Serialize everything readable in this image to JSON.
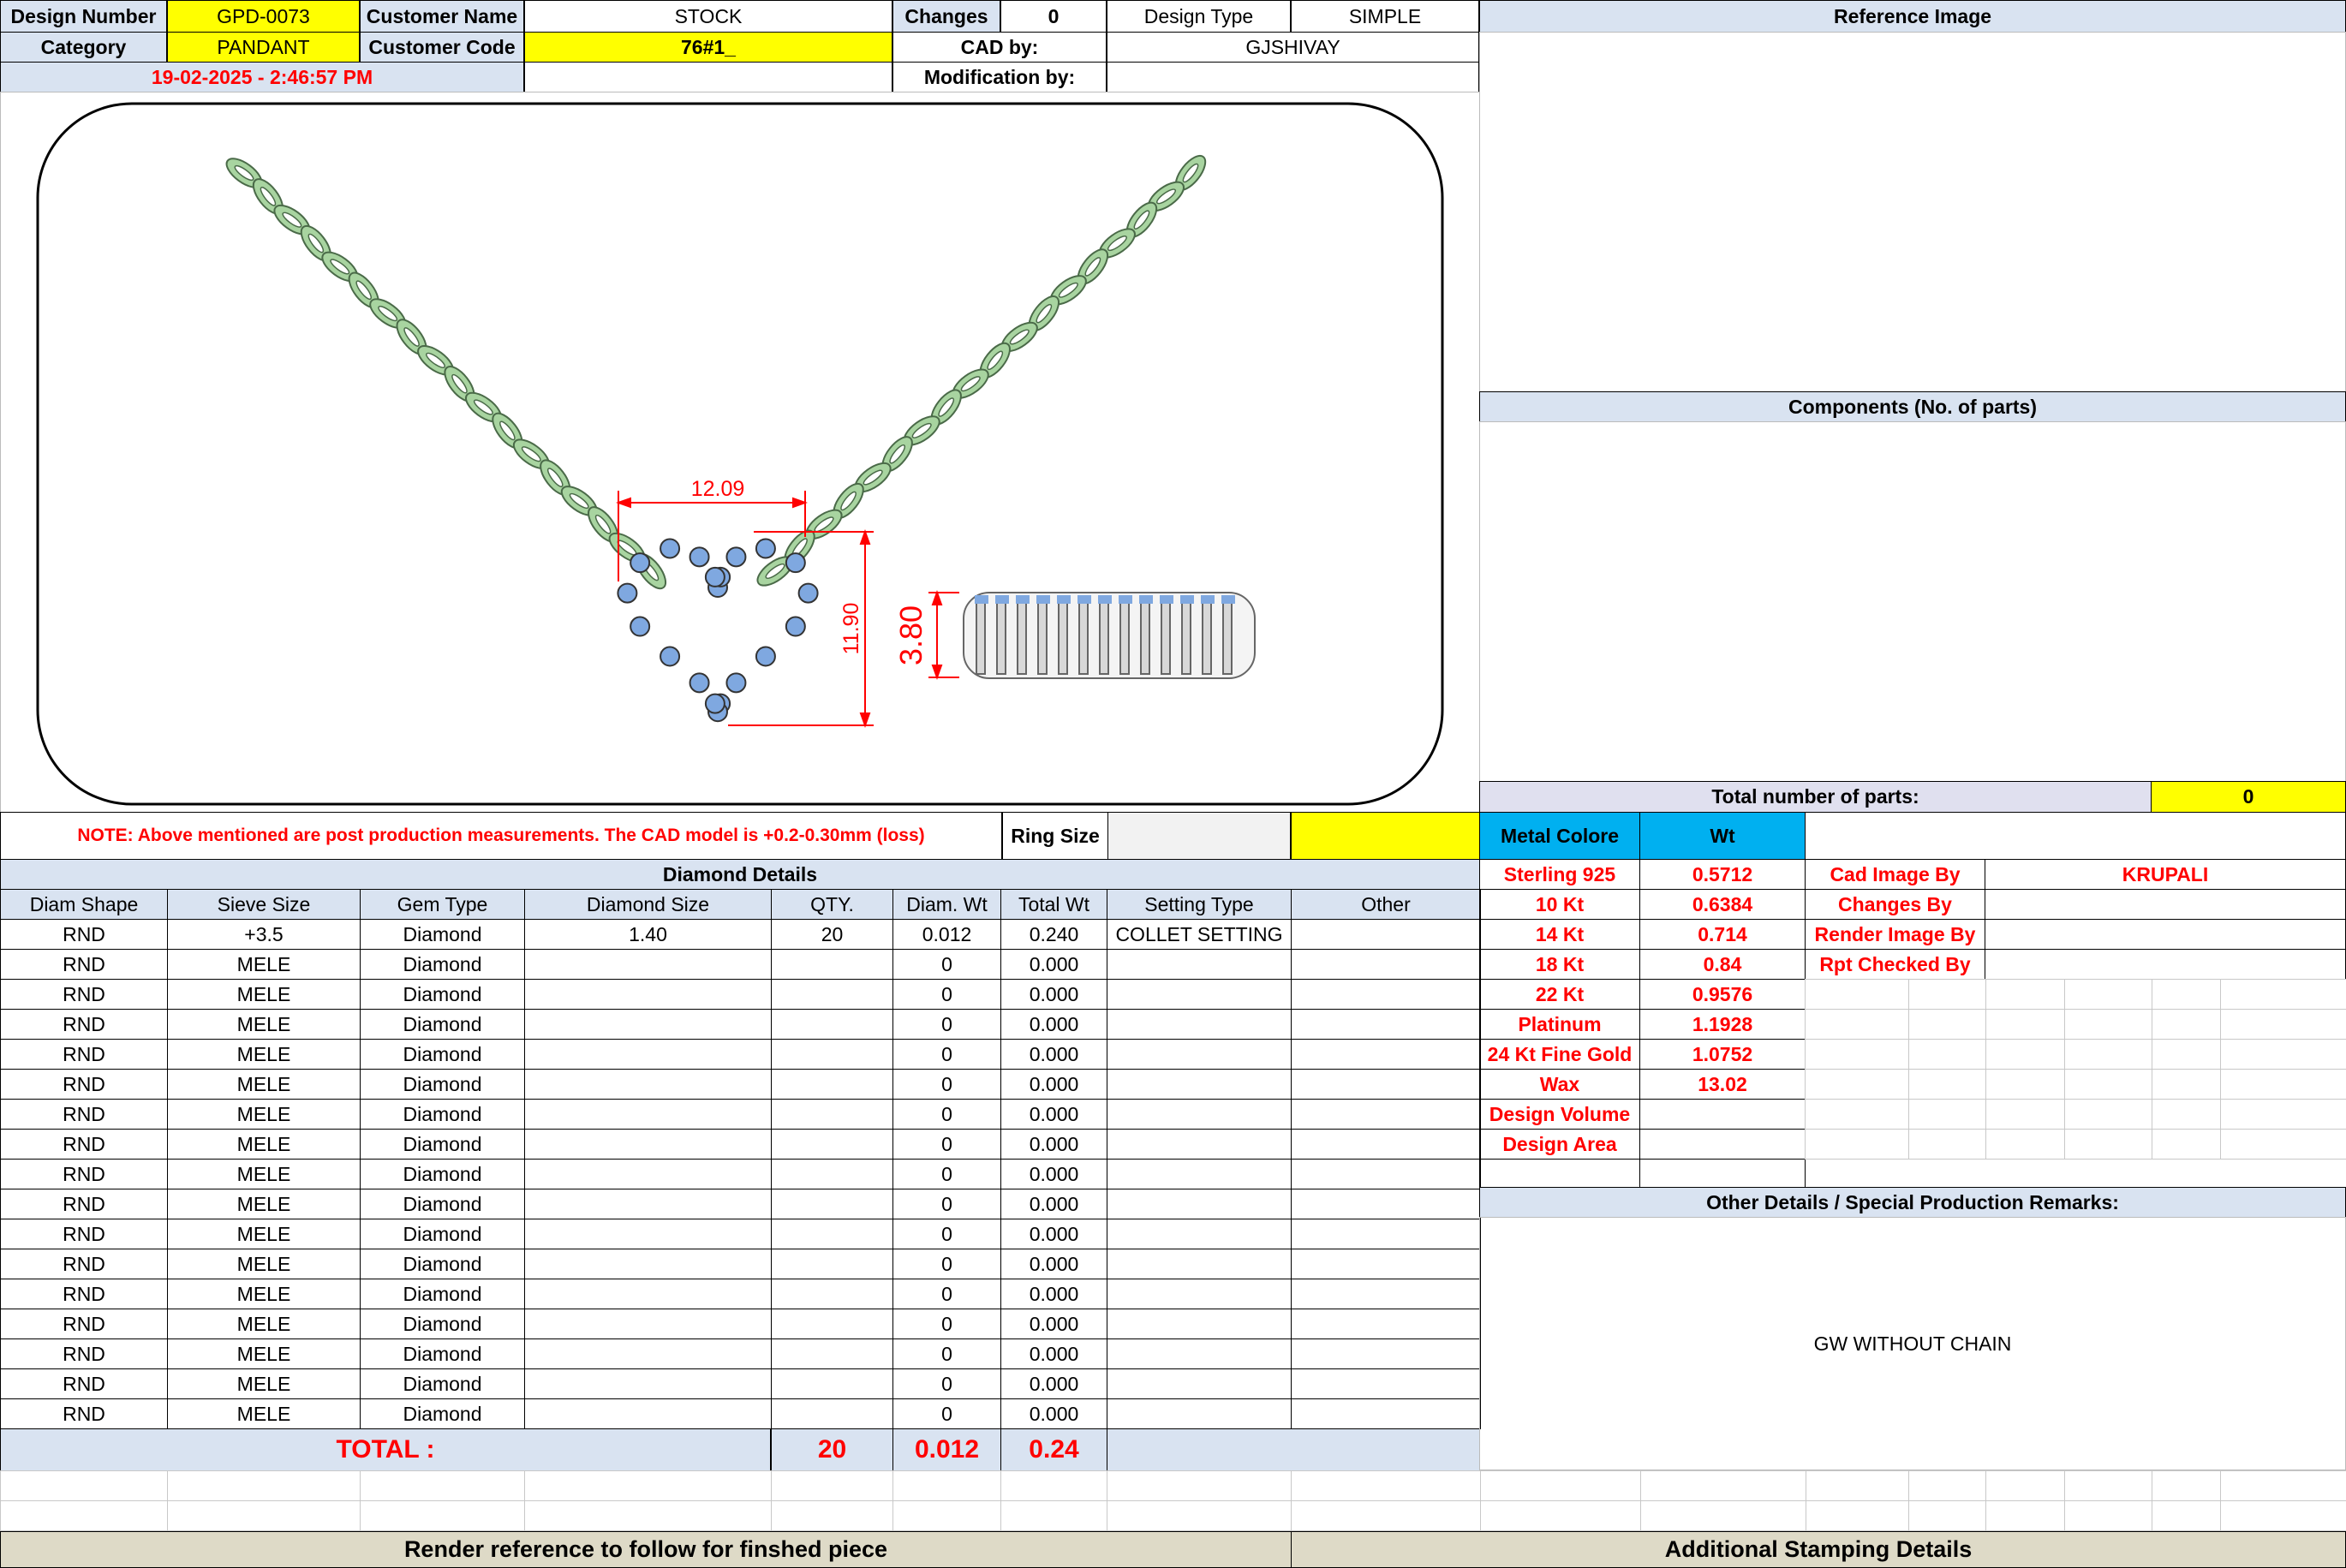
{
  "header": {
    "design_number_label": "Design Number",
    "design_number": "GPD-0073",
    "customer_name_label": "Customer Name",
    "customer_name": "STOCK",
    "changes_label": "Changes",
    "changes_value": "0",
    "design_type_label": "Design Type",
    "design_type": "SIMPLE",
    "reference_image_label": "Reference Image",
    "category_label": "Category",
    "category": "PANDANT",
    "customer_code_label": "Customer Code",
    "customer_code": "76#1_",
    "cad_by_label": "CAD by:",
    "cad_by": "GJSHIVAY",
    "date": "19-02-2025 - 2:46:57 PM",
    "modification_label": "Modification by:"
  },
  "drawing": {
    "width_dim": "12.09",
    "height_dim": "11.90",
    "thickness_dim": "3.80",
    "diamond_color": "#7fa8e0",
    "chain_color": "#a8d4a0"
  },
  "note": "NOTE: Above mentioned are post production measurements. The CAD model is +0.2-0.30mm (loss)",
  "ring_size_label": "Ring Size",
  "components_label": "Components (No. of parts)",
  "total_parts_label": "Total number of parts:",
  "total_parts_value": "0",
  "metal": {
    "header_label": "Metal Colore",
    "wt_label": "Wt",
    "rows": [
      {
        "name": "Sterling 925",
        "wt": "0.5712"
      },
      {
        "name": "10 Kt",
        "wt": "0.6384"
      },
      {
        "name": "14 Kt",
        "wt": "0.714"
      },
      {
        "name": "18 Kt",
        "wt": "0.84"
      },
      {
        "name": "22 Kt",
        "wt": "0.9576"
      },
      {
        "name": "Platinum",
        "wt": "1.1928"
      },
      {
        "name": "24 Kt Fine Gold",
        "wt": "1.0752"
      },
      {
        "name": "Wax",
        "wt": "13.02"
      },
      {
        "name": "Design Volume",
        "wt": ""
      },
      {
        "name": "Design Area",
        "wt": ""
      }
    ]
  },
  "credits": [
    {
      "label": "Cad Image By",
      "value": "KRUPALI"
    },
    {
      "label": "Changes By",
      "value": ""
    },
    {
      "label": "Render Image By",
      "value": ""
    },
    {
      "label": "Rpt Checked By",
      "value": ""
    }
  ],
  "diamond": {
    "title": "Diamond Details",
    "columns": [
      "Diam Shape",
      "Sieve Size",
      "Gem Type",
      "Diamond Size",
      "QTY.",
      "Diam. Wt",
      "Total Wt",
      "Setting Type",
      "Other"
    ],
    "rows": [
      [
        "RND",
        "+3.5",
        "Diamond",
        "1.40",
        "20",
        "0.012",
        "0.240",
        "COLLET SETTING",
        ""
      ],
      [
        "RND",
        "MELE",
        "Diamond",
        "",
        "",
        "0",
        "0.000",
        "",
        ""
      ],
      [
        "RND",
        "MELE",
        "Diamond",
        "",
        "",
        "0",
        "0.000",
        "",
        ""
      ],
      [
        "RND",
        "MELE",
        "Diamond",
        "",
        "",
        "0",
        "0.000",
        "",
        ""
      ],
      [
        "RND",
        "MELE",
        "Diamond",
        "",
        "",
        "0",
        "0.000",
        "",
        ""
      ],
      [
        "RND",
        "MELE",
        "Diamond",
        "",
        "",
        "0",
        "0.000",
        "",
        ""
      ],
      [
        "RND",
        "MELE",
        "Diamond",
        "",
        "",
        "0",
        "0.000",
        "",
        ""
      ],
      [
        "RND",
        "MELE",
        "Diamond",
        "",
        "",
        "0",
        "0.000",
        "",
        ""
      ],
      [
        "RND",
        "MELE",
        "Diamond",
        "",
        "",
        "0",
        "0.000",
        "",
        ""
      ],
      [
        "RND",
        "MELE",
        "Diamond",
        "",
        "",
        "0",
        "0.000",
        "",
        ""
      ],
      [
        "RND",
        "MELE",
        "Diamond",
        "",
        "",
        "0",
        "0.000",
        "",
        ""
      ],
      [
        "RND",
        "MELE",
        "Diamond",
        "",
        "",
        "0",
        "0.000",
        "",
        ""
      ],
      [
        "RND",
        "MELE",
        "Diamond",
        "",
        "",
        "0",
        "0.000",
        "",
        ""
      ],
      [
        "RND",
        "MELE",
        "Diamond",
        "",
        "",
        "0",
        "0.000",
        "",
        ""
      ],
      [
        "RND",
        "MELE",
        "Diamond",
        "",
        "",
        "0",
        "0.000",
        "",
        ""
      ],
      [
        "RND",
        "MELE",
        "Diamond",
        "",
        "",
        "0",
        "0.000",
        "",
        ""
      ],
      [
        "RND",
        "MELE",
        "Diamond",
        "",
        "",
        "0",
        "0.000",
        "",
        ""
      ]
    ],
    "total_label": "TOTAL :",
    "total_qty": "20",
    "total_diam_wt": "0.012",
    "total_wt": "0.24"
  },
  "other_details_label": "Other Details / Special Production Remarks:",
  "remarks": "GW WITHOUT CHAIN",
  "footer": {
    "render_reference": "Render reference to follow for finshed piece",
    "stamping": "Additional Stamping Details"
  }
}
